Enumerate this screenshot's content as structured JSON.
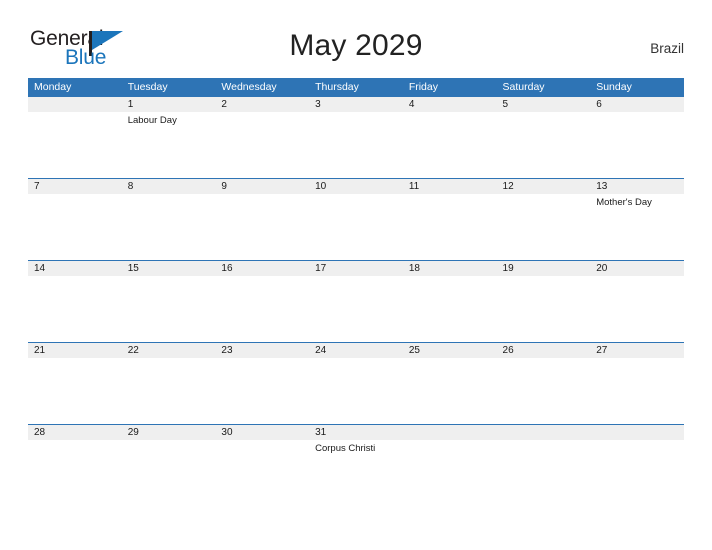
{
  "brand": {
    "name_part1": "General",
    "name_part2": "Blue",
    "flag_icon": "flag-icon",
    "colors": {
      "general_text": "#231f20",
      "blue_text": "#1b75bb",
      "accent": "#2e74b5",
      "band": "#efefef"
    }
  },
  "header": {
    "title": "May 2029",
    "country": "Brazil"
  },
  "calendar": {
    "weekdays": [
      "Monday",
      "Tuesday",
      "Wednesday",
      "Thursday",
      "Friday",
      "Saturday",
      "Sunday"
    ],
    "weeks": [
      [
        {
          "date": "",
          "event": ""
        },
        {
          "date": "1",
          "event": "Labour Day"
        },
        {
          "date": "2",
          "event": ""
        },
        {
          "date": "3",
          "event": ""
        },
        {
          "date": "4",
          "event": ""
        },
        {
          "date": "5",
          "event": ""
        },
        {
          "date": "6",
          "event": ""
        }
      ],
      [
        {
          "date": "7",
          "event": ""
        },
        {
          "date": "8",
          "event": ""
        },
        {
          "date": "9",
          "event": ""
        },
        {
          "date": "10",
          "event": ""
        },
        {
          "date": "11",
          "event": ""
        },
        {
          "date": "12",
          "event": ""
        },
        {
          "date": "13",
          "event": "Mother's Day"
        }
      ],
      [
        {
          "date": "14",
          "event": ""
        },
        {
          "date": "15",
          "event": ""
        },
        {
          "date": "16",
          "event": ""
        },
        {
          "date": "17",
          "event": ""
        },
        {
          "date": "18",
          "event": ""
        },
        {
          "date": "19",
          "event": ""
        },
        {
          "date": "20",
          "event": ""
        }
      ],
      [
        {
          "date": "21",
          "event": ""
        },
        {
          "date": "22",
          "event": ""
        },
        {
          "date": "23",
          "event": ""
        },
        {
          "date": "24",
          "event": ""
        },
        {
          "date": "25",
          "event": ""
        },
        {
          "date": "26",
          "event": ""
        },
        {
          "date": "27",
          "event": ""
        }
      ],
      [
        {
          "date": "28",
          "event": ""
        },
        {
          "date": "29",
          "event": ""
        },
        {
          "date": "30",
          "event": ""
        },
        {
          "date": "31",
          "event": "Corpus Christi"
        },
        {
          "date": "",
          "event": ""
        },
        {
          "date": "",
          "event": ""
        },
        {
          "date": "",
          "event": ""
        }
      ]
    ]
  }
}
